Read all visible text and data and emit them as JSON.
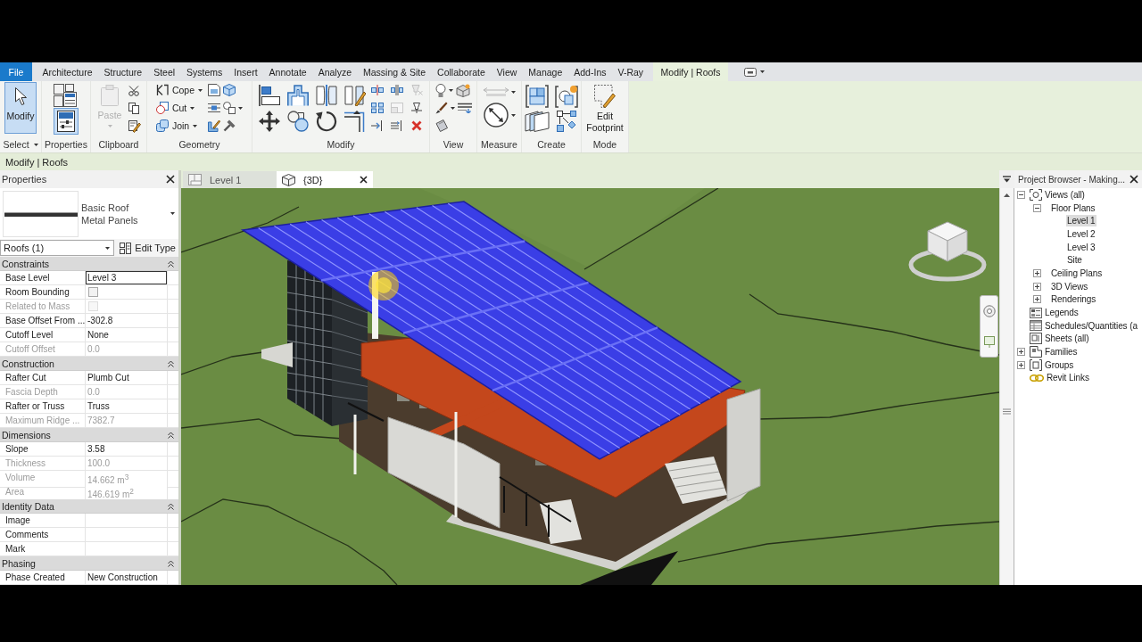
{
  "menu_tabs": [
    {
      "label": "File",
      "kind": "file",
      "selected": false
    },
    {
      "label": "Architecture",
      "kind": "tab",
      "selected": false
    },
    {
      "label": "Structure",
      "kind": "tab",
      "selected": false
    },
    {
      "label": "Steel",
      "kind": "tab",
      "selected": false
    },
    {
      "label": "Systems",
      "kind": "tab",
      "selected": false
    },
    {
      "label": "Insert",
      "kind": "tab",
      "selected": false
    },
    {
      "label": "Annotate",
      "kind": "tab",
      "selected": false
    },
    {
      "label": "Analyze",
      "kind": "tab",
      "selected": false
    },
    {
      "label": "Massing & Site",
      "kind": "tab",
      "selected": false
    },
    {
      "label": "Collaborate",
      "kind": "tab",
      "selected": false
    },
    {
      "label": "View",
      "kind": "tab",
      "selected": false
    },
    {
      "label": "Manage",
      "kind": "tab",
      "selected": false
    },
    {
      "label": "Add-Ins",
      "kind": "tab",
      "selected": false
    },
    {
      "label": "V-Ray",
      "kind": "tab",
      "selected": false
    },
    {
      "label": "Modify | Roofs",
      "kind": "context",
      "selected": true
    }
  ],
  "ribbon": {
    "panels": [
      {
        "kind": "select",
        "label": "Select",
        "tools": [
          {
            "label": "Modify",
            "active": true
          }
        ]
      },
      {
        "kind": "properties",
        "label": "Properties",
        "palette_on": true
      },
      {
        "kind": "clipboard",
        "label": "Clipboard",
        "tools": [
          {
            "label": "Paste",
            "disabled": true
          }
        ]
      },
      {
        "kind": "geometry",
        "label": "Geometry",
        "tools": [
          {
            "label": "Cope"
          },
          {
            "label": "Cut"
          },
          {
            "label": "Join"
          }
        ]
      },
      {
        "kind": "modify",
        "label": "Modify"
      },
      {
        "kind": "view",
        "label": "View"
      },
      {
        "kind": "measure",
        "label": "Measure"
      },
      {
        "kind": "create",
        "label": "Create"
      },
      {
        "kind": "mode",
        "label": "Mode",
        "tools": [
          {
            "label": "Edit Footprint"
          }
        ]
      }
    ]
  },
  "options_bar": {
    "title": "Modify | Roofs"
  },
  "properties": {
    "title": "Properties",
    "type_family": "Basic Roof",
    "type_name": "Metal Panels",
    "filter": "Roofs (1)",
    "edit_type": "Edit Type",
    "groups": [
      {
        "name": "Constraints",
        "expanded": true,
        "rows": [
          {
            "label": "Base Level",
            "kind": "text",
            "value": "Level 3",
            "active": true,
            "disabled": false
          },
          {
            "label": "Room Bounding",
            "kind": "checkbox",
            "checked": false,
            "active": false,
            "disabled": false
          },
          {
            "label": "Related to Mass",
            "kind": "checkbox",
            "checked": false,
            "active": false,
            "disabled": true
          },
          {
            "label": "Base Offset From ...",
            "kind": "text",
            "value": "-302.8",
            "active": false,
            "disabled": false
          },
          {
            "label": "Cutoff Level",
            "kind": "text",
            "value": "None",
            "active": false,
            "disabled": false
          },
          {
            "label": "Cutoff Offset",
            "kind": "text",
            "value": "0.0",
            "active": false,
            "disabled": true
          }
        ]
      },
      {
        "name": "Construction",
        "expanded": true,
        "rows": [
          {
            "label": "Rafter Cut",
            "kind": "text",
            "value": "Plumb Cut",
            "active": false,
            "disabled": false
          },
          {
            "label": "Fascia Depth",
            "kind": "text",
            "value": "0.0",
            "active": false,
            "disabled": true
          },
          {
            "label": "Rafter or Truss",
            "kind": "text",
            "value": "Truss",
            "active": false,
            "disabled": false
          },
          {
            "label": "Maximum Ridge ...",
            "kind": "text",
            "value": "7382.7",
            "active": false,
            "disabled": true
          }
        ]
      },
      {
        "name": "Dimensions",
        "expanded": true,
        "rows": [
          {
            "label": "Slope",
            "kind": "text",
            "value": "3.58",
            "active": false,
            "disabled": false
          },
          {
            "label": "Thickness",
            "kind": "text",
            "value": "100.0",
            "active": false,
            "disabled": true
          },
          {
            "label": "Volume",
            "kind": "text",
            "value": "14.662 m$^{3}$",
            "active": false,
            "disabled": true
          },
          {
            "label": "Area",
            "kind": "text",
            "value": "146.619 m$^{2}$",
            "active": false,
            "disabled": true
          }
        ]
      },
      {
        "name": "Identity Data",
        "expanded": true,
        "rows": [
          {
            "label": "Image",
            "kind": "text",
            "active": false,
            "disabled": false
          },
          {
            "label": "Comments",
            "kind": "text",
            "active": false,
            "disabled": false
          },
          {
            "label": "Mark",
            "kind": "text",
            "active": false,
            "disabled": false
          }
        ]
      },
      {
        "name": "Phasing",
        "expanded": true,
        "rows": [
          {
            "label": "Phase Created",
            "kind": "text",
            "value": "New Construction",
            "active": false,
            "disabled": false
          }
        ]
      }
    ]
  },
  "view_tabs": [
    {
      "label": "Level 1",
      "kind": "plan",
      "selected": false
    },
    {
      "label": "{3D}",
      "kind": "model",
      "selected": true
    }
  ],
  "project_browser": {
    "title": "Project Browser - Making...",
    "items": [
      {
        "label": "Views (all)",
        "kind": "views",
        "expanded": true,
        "selected": false,
        "children": [
          {
            "label": "Floor Plans",
            "expanded": true,
            "selected": false,
            "children": [
              {
                "label": "Level 1",
                "selected": true
              },
              {
                "label": "Level 2",
                "selected": false
              },
              {
                "label": "Level 3",
                "selected": false
              },
              {
                "label": "Site",
                "selected": false
              }
            ]
          },
          {
            "label": "Ceiling Plans",
            "expanded": false,
            "selected": false
          },
          {
            "label": "3D Views",
            "expanded": false,
            "selected": false
          },
          {
            "label": "Renderings",
            "expanded": false,
            "selected": false
          }
        ]
      },
      {
        "label": "Legends",
        "kind": "legends",
        "selected": false
      },
      {
        "label": "Schedules/Quantities (a",
        "kind": "schedules",
        "selected": false
      },
      {
        "label": "Sheets (all)",
        "kind": "sheets",
        "selected": false
      },
      {
        "label": "Families",
        "kind": "families",
        "expanded": false,
        "selected": false
      },
      {
        "label": "Groups",
        "kind": "groups",
        "expanded": false,
        "selected": false
      },
      {
        "label": "Revit Links",
        "kind": "links",
        "selected": false
      }
    ]
  }
}
